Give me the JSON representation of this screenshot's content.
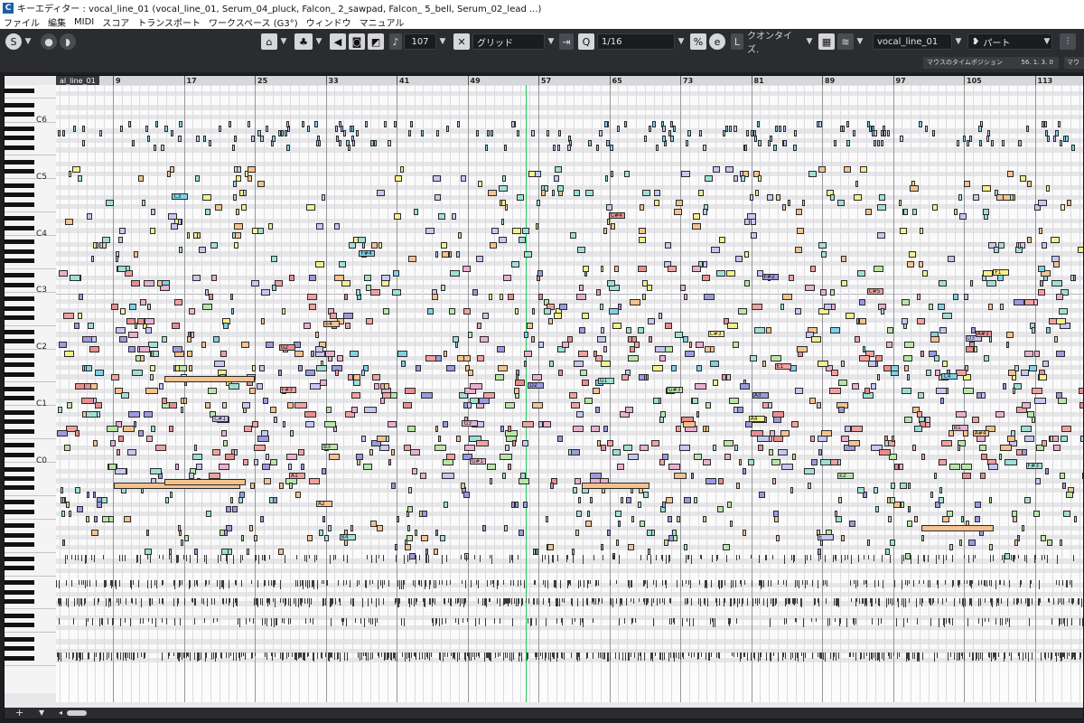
{
  "window": {
    "icon": "cubase-key-editor-icon",
    "title": "キーエディター : vocal_line_01 (vocal_line_01, Serum_04_pluck, Falcon_ 2_sawpad, Falcon_ 5_bell, Serum_02_lead ...)"
  },
  "menu": [
    "ファイル",
    "編集",
    "MIDI",
    "スコア",
    "トランスポート",
    "ワークスペース (G3°)",
    "ウィンドウ",
    "マニュアル"
  ],
  "toolbar": {
    "velocity": "107",
    "grid_type": "グリッド",
    "quantize_value": "1/16",
    "quantize_label": "クオンタイズ.",
    "track_name": "vocal_line_01",
    "part_label": "パート"
  },
  "info": {
    "mouse_pos_label": "マウスのタイムポジション",
    "mouse_pos_value": "56. 1. 3.   0",
    "mouse_pos2_label": "マウスの"
  },
  "ruler": {
    "part_name": "al_line_01",
    "bars": [
      "9",
      "17",
      "25",
      "33",
      "41",
      "49",
      "57",
      "65",
      "73",
      "81",
      "89",
      "97",
      "105",
      "113"
    ]
  },
  "keyboard": {
    "octaves": [
      "C6",
      "C5",
      "C4",
      "C3",
      "C2",
      "C1",
      "C0"
    ]
  },
  "note_labels": [
    "C#5",
    "B4",
    "E",
    "A4",
    "C4",
    "E4",
    "C#4",
    "B3",
    "A3",
    "G3",
    "F#3",
    "F#3",
    "D3",
    "C#3",
    "C3",
    "A2",
    "G2",
    "E2",
    "D2",
    "B1",
    "A1",
    "G1",
    "C#1",
    "F1",
    "F#4",
    "A#4",
    "A#3",
    "G#3",
    "F#2",
    "G#1",
    "E1"
  ],
  "colors": {
    "accent": "#2b2c30",
    "playhead": "#21c65c",
    "note_palette": [
      "#f2a0a0",
      "#9fe0d6",
      "#c7c7f5",
      "#f6f08a",
      "#7fd1e8",
      "#f4c28e",
      "#e88e8e",
      "#b9e6a8",
      "#9a9ae0",
      "#e9b0d0"
    ]
  }
}
